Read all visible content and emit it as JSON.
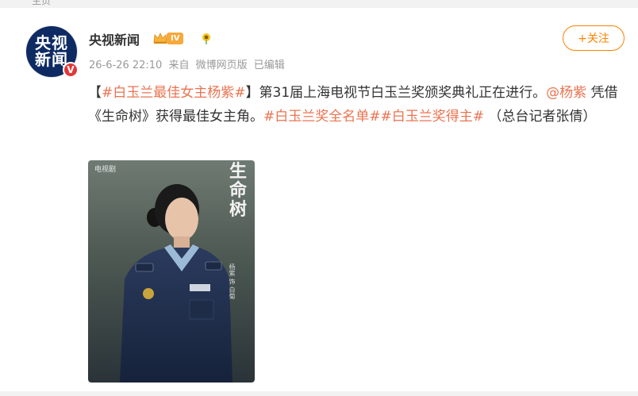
{
  "top_strip": {
    "text": "主页"
  },
  "account": {
    "name": "央视新闻",
    "avatar_line1": "央视",
    "avatar_line2": "新闻",
    "verified_mark": "V",
    "level": "IV"
  },
  "meta": {
    "time": "26-6-26 22:10",
    "source_prefix": "来自",
    "source": "微博网页版",
    "edited": "已编辑"
  },
  "follow_button": {
    "label": "+关注"
  },
  "post": {
    "topic_1": "#白玉兰最佳女主杨紫#",
    "bracket_open": "【",
    "bracket_close": "】",
    "text_1": "第31届上海电视节白玉兰奖颁奖典礼正在进行。",
    "mention": "@杨紫",
    "text_2": " 凭借《生命树》获得最佳女主角。",
    "topic_2": "#白玉兰奖全名单#",
    "topic_3": "#白玉兰奖得主#",
    "text_3": " （总台记者张倩）"
  },
  "poster": {
    "logo": "电视剧",
    "title": "生命树",
    "credit": "杨紫 饰 白菊"
  },
  "colors": {
    "accent": "#ff8200",
    "link": "#eb7350",
    "text": "#333333",
    "meta": "#999999",
    "avatar_bg": "#0d2a63",
    "verified": "#e23737"
  }
}
